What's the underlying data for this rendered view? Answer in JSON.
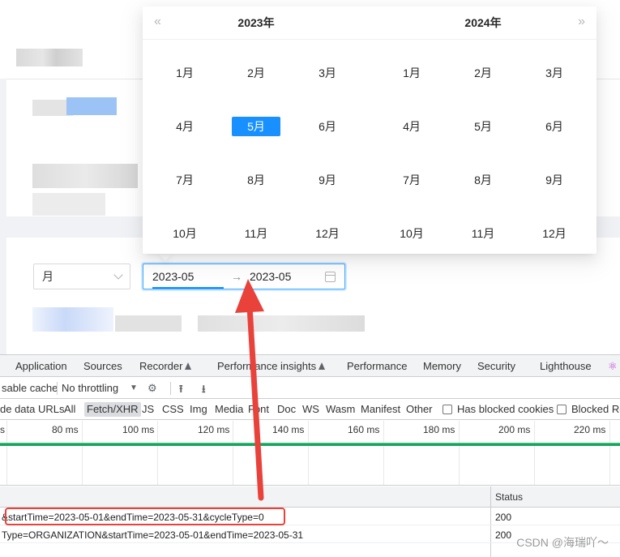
{
  "period_select": {
    "value": "月"
  },
  "range_picker": {
    "start": "2023-05",
    "separator": "→",
    "end": "2023-05"
  },
  "calendar": {
    "left": {
      "year": "2023年",
      "months": [
        "1月",
        "2月",
        "3月",
        "4月",
        "5月",
        "6月",
        "7月",
        "8月",
        "9月",
        "10月",
        "11月",
        "12月"
      ],
      "selected_index": 4
    },
    "right": {
      "year": "2024年",
      "months": [
        "1月",
        "2月",
        "3月",
        "4月",
        "5月",
        "6月",
        "7月",
        "8月",
        "9月",
        "10月",
        "11月",
        "12月"
      ]
    },
    "prev_glyph": "«",
    "next_glyph": "»"
  },
  "devtools": {
    "tabs": [
      "Application",
      "Sources",
      "Recorder",
      "Performance insights",
      "Performance",
      "Memory",
      "Security",
      "Lighthouse"
    ],
    "react_glyph": "⚛",
    "toolbar": {
      "cache": "sable cache",
      "throttling": "No throttling",
      "dropdown_glyph": "▼"
    },
    "filters": {
      "items": [
        "de data URLs",
        "All",
        "Fetch/XHR",
        "JS",
        "CSS",
        "Img",
        "Media",
        "Font",
        "Doc",
        "WS",
        "Wasm",
        "Manifest",
        "Other"
      ],
      "active": "Fetch/XHR",
      "blocked_cookies": "Has blocked cookies",
      "blocked_requests": "Blocked Re"
    },
    "timeline_ticks": [
      "s",
      "80 ms",
      "100 ms",
      "120 ms",
      "140 ms",
      "160 ms",
      "180 ms",
      "200 ms",
      "220 ms"
    ],
    "table": {
      "status_header": "Status",
      "rows": [
        {
          "url": "&startTime=2023-05-01&endTime=2023-05-31&cycleType=0",
          "status": "200"
        },
        {
          "url": "Type=ORGANIZATION&startTime=2023-05-01&endTime=2023-05-31",
          "status": "200"
        }
      ]
    }
  },
  "watermark": "CSDN @海瑞吖～",
  "colors": {
    "accent": "#1890ff",
    "annotation": "#e8423b",
    "devtools_wave": "#1aa260"
  }
}
